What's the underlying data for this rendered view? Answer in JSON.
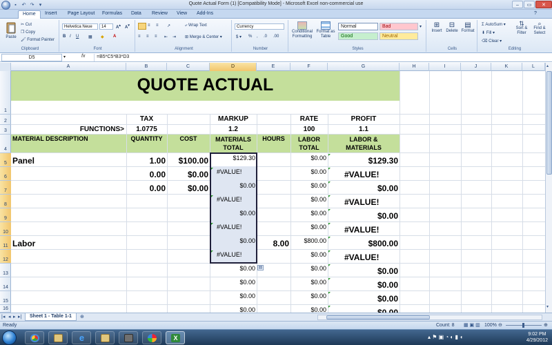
{
  "window": {
    "title": "Quote Actual Form (1)  [Compatibility Mode] - Microsoft Excel non-commercial use",
    "controls": [
      "–",
      "▭",
      "✕"
    ]
  },
  "ribbon_tabs": [
    "Home",
    "Insert",
    "Page Layout",
    "Formulas",
    "Data",
    "Review",
    "View",
    "Add-Ins"
  ],
  "ribbon": {
    "clipboard": {
      "label": "Clipboard",
      "paste": "Paste",
      "cut": "Cut",
      "copy": "Copy",
      "format_painter": "Format Painter"
    },
    "font": {
      "label": "Font",
      "name": "Helvetica Neue",
      "size": "14"
    },
    "alignment": {
      "label": "Alignment",
      "wrap_text": "Wrap Text",
      "merge_center": "Merge & Center"
    },
    "number": {
      "label": "Number",
      "format": "Currency"
    },
    "styles": {
      "label": "Styles",
      "conditional": "Conditional Formatting",
      "format_table": "Format as Table",
      "normal": "Normal",
      "bad": "Bad",
      "good": "Good",
      "neutral": "Neutral"
    },
    "cells": {
      "label": "Cells",
      "insert": "Insert",
      "delete": "Delete",
      "format": "Format"
    },
    "editing": {
      "label": "Editing",
      "autosum": "AutoSum",
      "fill": "Fill",
      "clear": "Clear",
      "sort_filter": "Sort & Filter",
      "find_select": "Find & Select"
    }
  },
  "formula_bar": {
    "name_box": "D5",
    "fx": "fx",
    "formula": "=B5*C5*B3*D3"
  },
  "columns": [
    "A",
    "B",
    "C",
    "D",
    "E",
    "F",
    "G",
    "H",
    "I",
    "J",
    "K",
    "L"
  ],
  "rows": [
    "1",
    "2",
    "3",
    "4",
    "5",
    "6",
    "7",
    "8",
    "9",
    "10",
    "11",
    "12",
    "13",
    "14",
    "15",
    "16"
  ],
  "sheet": {
    "title": "QUOTE ACTUAL",
    "row2": {
      "tax": "TAX",
      "markup": "MARKUP",
      "rate": "RATE",
      "profit": "PROFIT"
    },
    "row3": {
      "label": "FUNCTIONS>",
      "tax": "1.0775",
      "markup": "1.2",
      "rate": "100",
      "profit": "1.1"
    },
    "headers": {
      "a": "MATERIAL  DESCRIPTION",
      "b": "QUANTITY",
      "c": "COST",
      "d": "MATERIALS TOTAL",
      "e": "HOURS",
      "f": "LABOR TOTAL",
      "g": "LABOR & MATERIALS"
    },
    "rows": [
      {
        "a": "Panel",
        "b": "1.00",
        "c": "$100.00",
        "d": "$129.30",
        "e": "",
        "f": "$0.00",
        "g": "$129.30"
      },
      {
        "a": "",
        "b": "0.00",
        "c": "$0.00",
        "d": "#VALUE!",
        "e": "",
        "f": "$0.00",
        "g": "#VALUE!"
      },
      {
        "a": "",
        "b": "0.00",
        "c": "$0.00",
        "d": "$0.00",
        "e": "",
        "f": "$0.00",
        "g": "$0.00"
      },
      {
        "a": "",
        "b": "",
        "c": "",
        "d": "#VALUE!",
        "e": "",
        "f": "$0.00",
        "g": "#VALUE!"
      },
      {
        "a": "",
        "b": "",
        "c": "",
        "d": "$0.00",
        "e": "",
        "f": "$0.00",
        "g": "$0.00"
      },
      {
        "a": "",
        "b": "",
        "c": "",
        "d": "#VALUE!",
        "e": "",
        "f": "$0.00",
        "g": "#VALUE!"
      },
      {
        "a": "Labor",
        "b": "",
        "c": "",
        "d": "$0.00",
        "e": "8.00",
        "f": "$800.00",
        "g": "$800.00"
      },
      {
        "a": "",
        "b": "",
        "c": "",
        "d": "#VALUE!",
        "e": "",
        "f": "$0.00",
        "g": "#VALUE!"
      },
      {
        "a": "",
        "b": "",
        "c": "",
        "d": "$0.00",
        "e": "",
        "f": "$0.00",
        "g": "$0.00"
      },
      {
        "a": "",
        "b": "",
        "c": "",
        "d": "$0.00",
        "e": "",
        "f": "$0.00",
        "g": "$0.00"
      },
      {
        "a": "",
        "b": "",
        "c": "",
        "d": "$0.00",
        "e": "",
        "f": "$0.00",
        "g": "$0.00"
      },
      {
        "a": "",
        "b": "",
        "c": "",
        "d": "$0.00",
        "e": "",
        "f": "$0.00",
        "g": "$0.00"
      }
    ]
  },
  "sheet_tab": "Sheet 1 - Table 1-1",
  "status": {
    "ready": "Ready",
    "count": "Count: 8",
    "zoom": "100%"
  },
  "clock": {
    "time": "9:02 PM",
    "date": "4/29/2012"
  },
  "colors": {
    "header_green": "#c4df9b",
    "selection_gold": "#f2c66d"
  }
}
